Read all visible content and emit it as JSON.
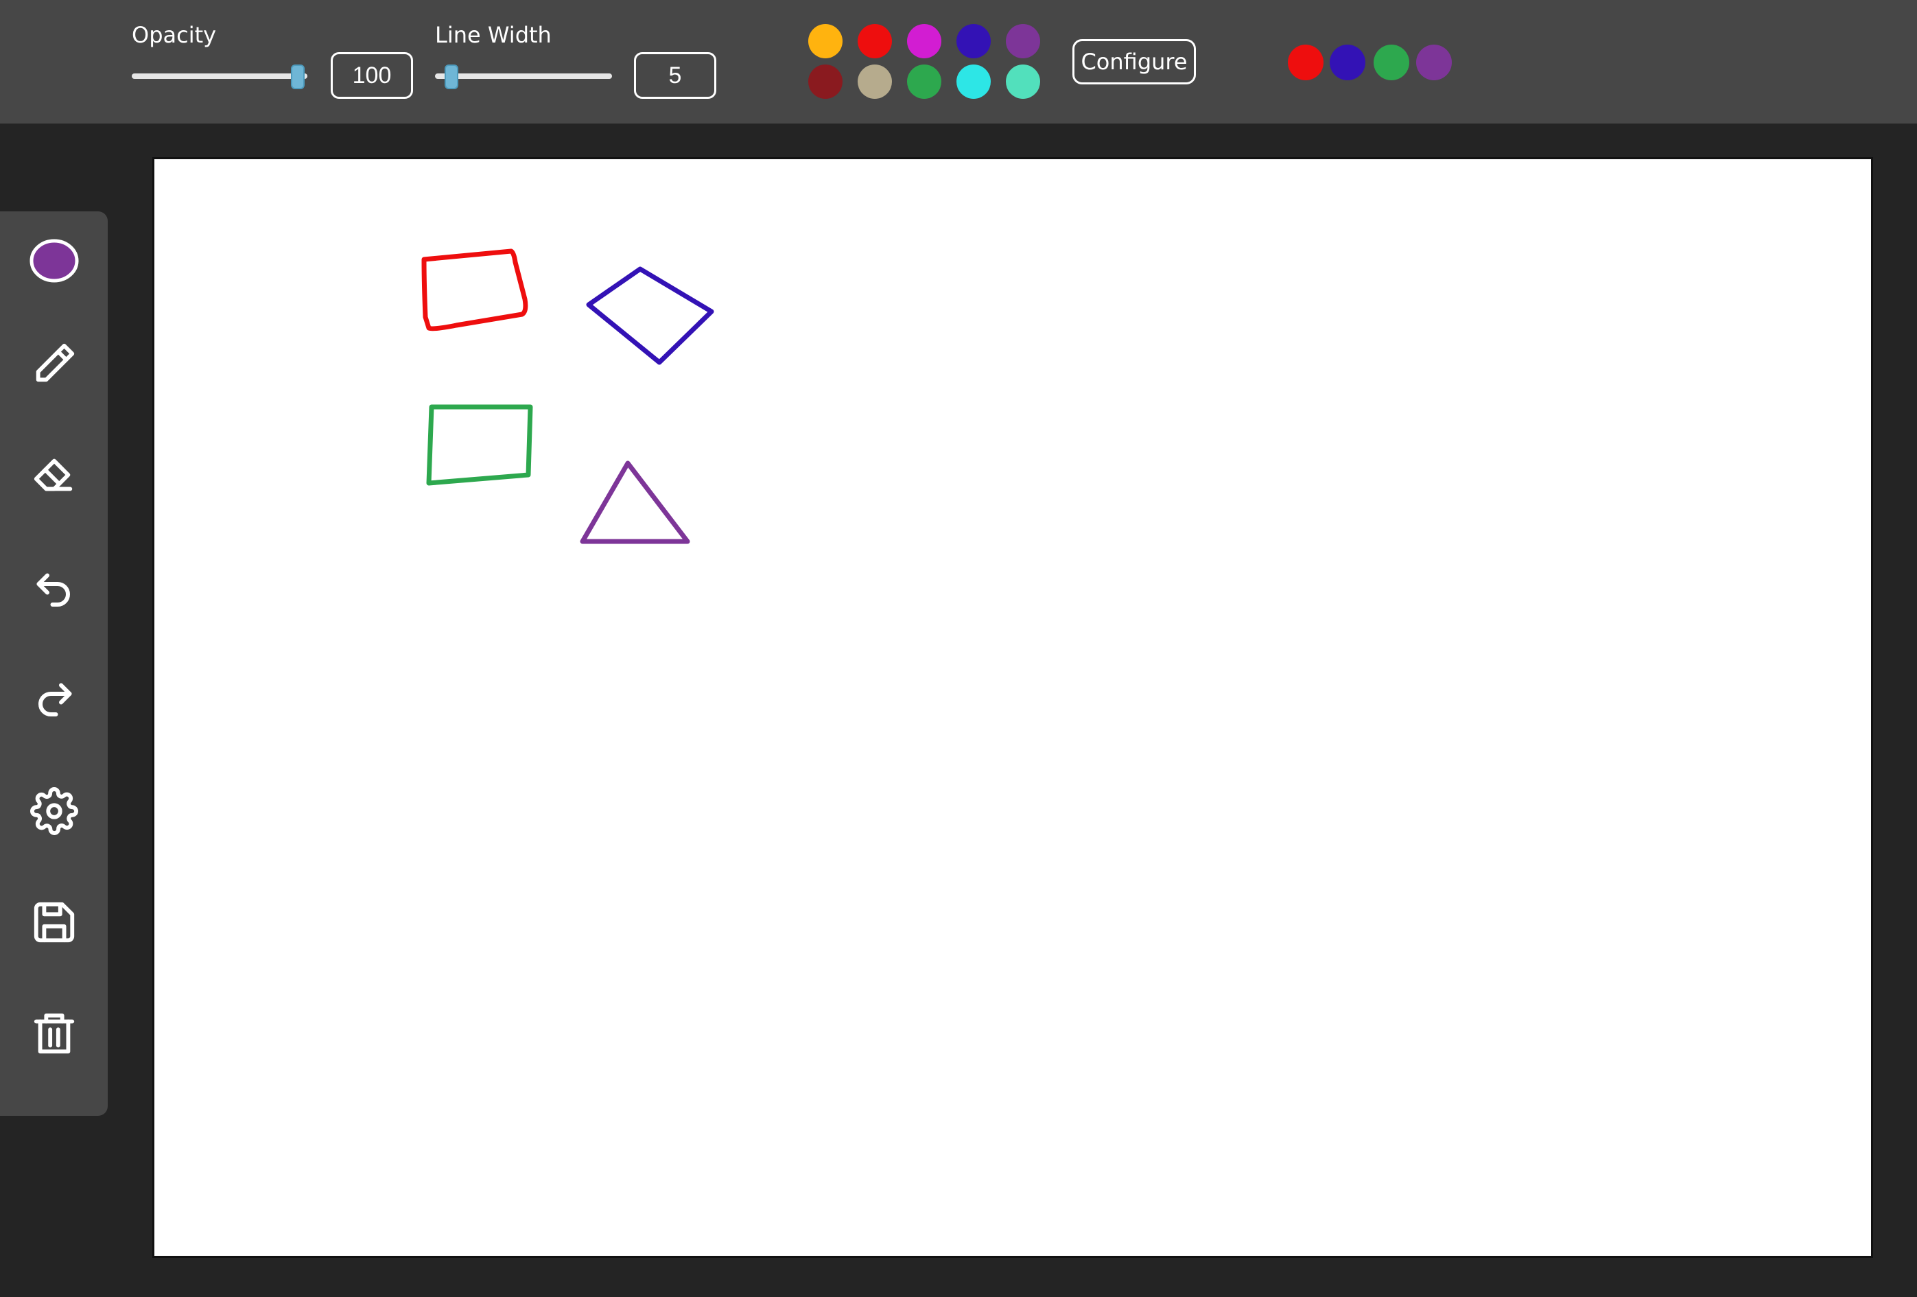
{
  "toolbar": {
    "opacity_label": "Opacity",
    "opacity_value": "100",
    "opacity_fraction": 1.0,
    "line_width_label": "Line Width",
    "line_width_value": "5",
    "line_width_fraction": 0.05,
    "configure_label": "Configure",
    "palette": [
      {
        "name": "orange",
        "color": "#ffb30f"
      },
      {
        "name": "red",
        "color": "#ee0e0e"
      },
      {
        "name": "magenta",
        "color": "#d21dd2"
      },
      {
        "name": "indigo",
        "color": "#3312b5"
      },
      {
        "name": "purple",
        "color": "#7d3598"
      },
      {
        "name": "dark-red",
        "color": "#8a1a1f"
      },
      {
        "name": "tan",
        "color": "#b6ab8d"
      },
      {
        "name": "green",
        "color": "#2da84e"
      },
      {
        "name": "cyan",
        "color": "#2de6e6"
      },
      {
        "name": "aquamarine",
        "color": "#52e0bc"
      }
    ],
    "recent_colors": [
      {
        "name": "red",
        "color": "#ee0e0e"
      },
      {
        "name": "indigo",
        "color": "#3312b5"
      },
      {
        "name": "green",
        "color": "#2da84e"
      },
      {
        "name": "purple",
        "color": "#7d3598"
      }
    ]
  },
  "sidebar": {
    "current_color": "#7d3598",
    "tools": [
      "current-color-icon",
      "pencil-icon",
      "eraser-icon",
      "undo-icon",
      "redo-icon",
      "gear-icon",
      "save-icon",
      "trash-icon"
    ]
  },
  "canvas": {
    "shapes": [
      {
        "name": "red-quadrilateral",
        "color": "#ee0e0e"
      },
      {
        "name": "indigo-diamond",
        "color": "#3312b5"
      },
      {
        "name": "green-rectangle",
        "color": "#2da84e"
      },
      {
        "name": "purple-triangle",
        "color": "#7d3598"
      }
    ]
  }
}
